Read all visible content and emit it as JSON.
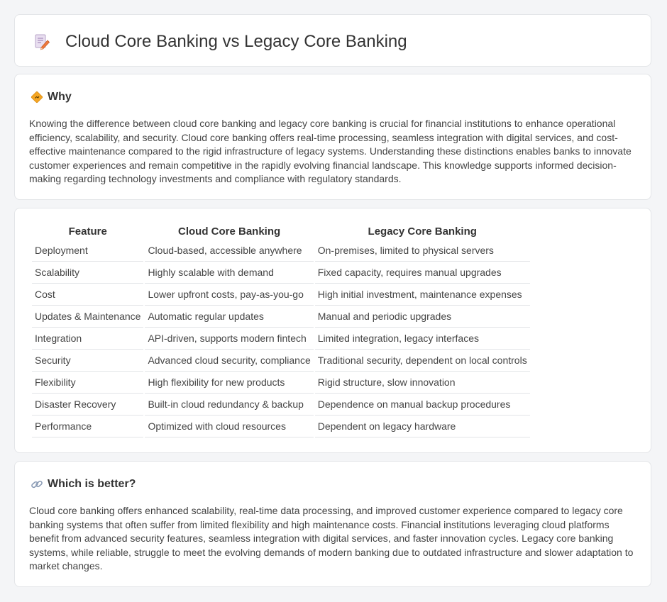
{
  "header": {
    "title": "Cloud Core Banking vs Legacy Core Banking",
    "icon": "document-pencil-icon"
  },
  "why": {
    "heading": "Why",
    "icon": "diamond-sign-icon",
    "text": "Knowing the difference between cloud core banking and legacy core banking is crucial for financial institutions to enhance operational efficiency, scalability, and security. Cloud core banking offers real-time processing, seamless integration with digital services, and cost-effective maintenance compared to the rigid infrastructure of legacy systems. Understanding these distinctions enables banks to innovate customer experiences and remain competitive in the rapidly evolving financial landscape. This knowledge supports informed decision-making regarding technology investments and compliance with regulatory standards."
  },
  "comparison": {
    "headers": [
      "Feature",
      "Cloud Core Banking",
      "Legacy Core Banking"
    ],
    "rows": [
      [
        "Deployment",
        "Cloud-based, accessible anywhere",
        "On-premises, limited to physical servers"
      ],
      [
        "Scalability",
        "Highly scalable with demand",
        "Fixed capacity, requires manual upgrades"
      ],
      [
        "Cost",
        "Lower upfront costs, pay-as-you-go",
        "High initial investment, maintenance expenses"
      ],
      [
        "Updates & Maintenance",
        "Automatic regular updates",
        "Manual and periodic upgrades"
      ],
      [
        "Integration",
        "API-driven, supports modern fintech",
        "Limited integration, legacy interfaces"
      ],
      [
        "Security",
        "Advanced cloud security, compliance",
        "Traditional security, dependent on local controls"
      ],
      [
        "Flexibility",
        "High flexibility for new products",
        "Rigid structure, slow innovation"
      ],
      [
        "Disaster Recovery",
        "Built-in cloud redundancy & backup",
        "Dependence on manual backup procedures"
      ],
      [
        "Performance",
        "Optimized with cloud resources",
        "Dependent on legacy hardware"
      ]
    ]
  },
  "better": {
    "heading": "Which is better?",
    "icon": "link-icon",
    "text": "Cloud core banking offers enhanced scalability, real-time data processing, and improved customer experience compared to legacy core banking systems that often suffer from limited flexibility and high maintenance costs. Financial institutions leveraging cloud platforms benefit from advanced security features, seamless integration with digital services, and faster innovation cycles. Legacy core banking systems, while reliable, struggle to meet the evolving demands of modern banking due to outdated infrastructure and slower adaptation to market changes."
  }
}
